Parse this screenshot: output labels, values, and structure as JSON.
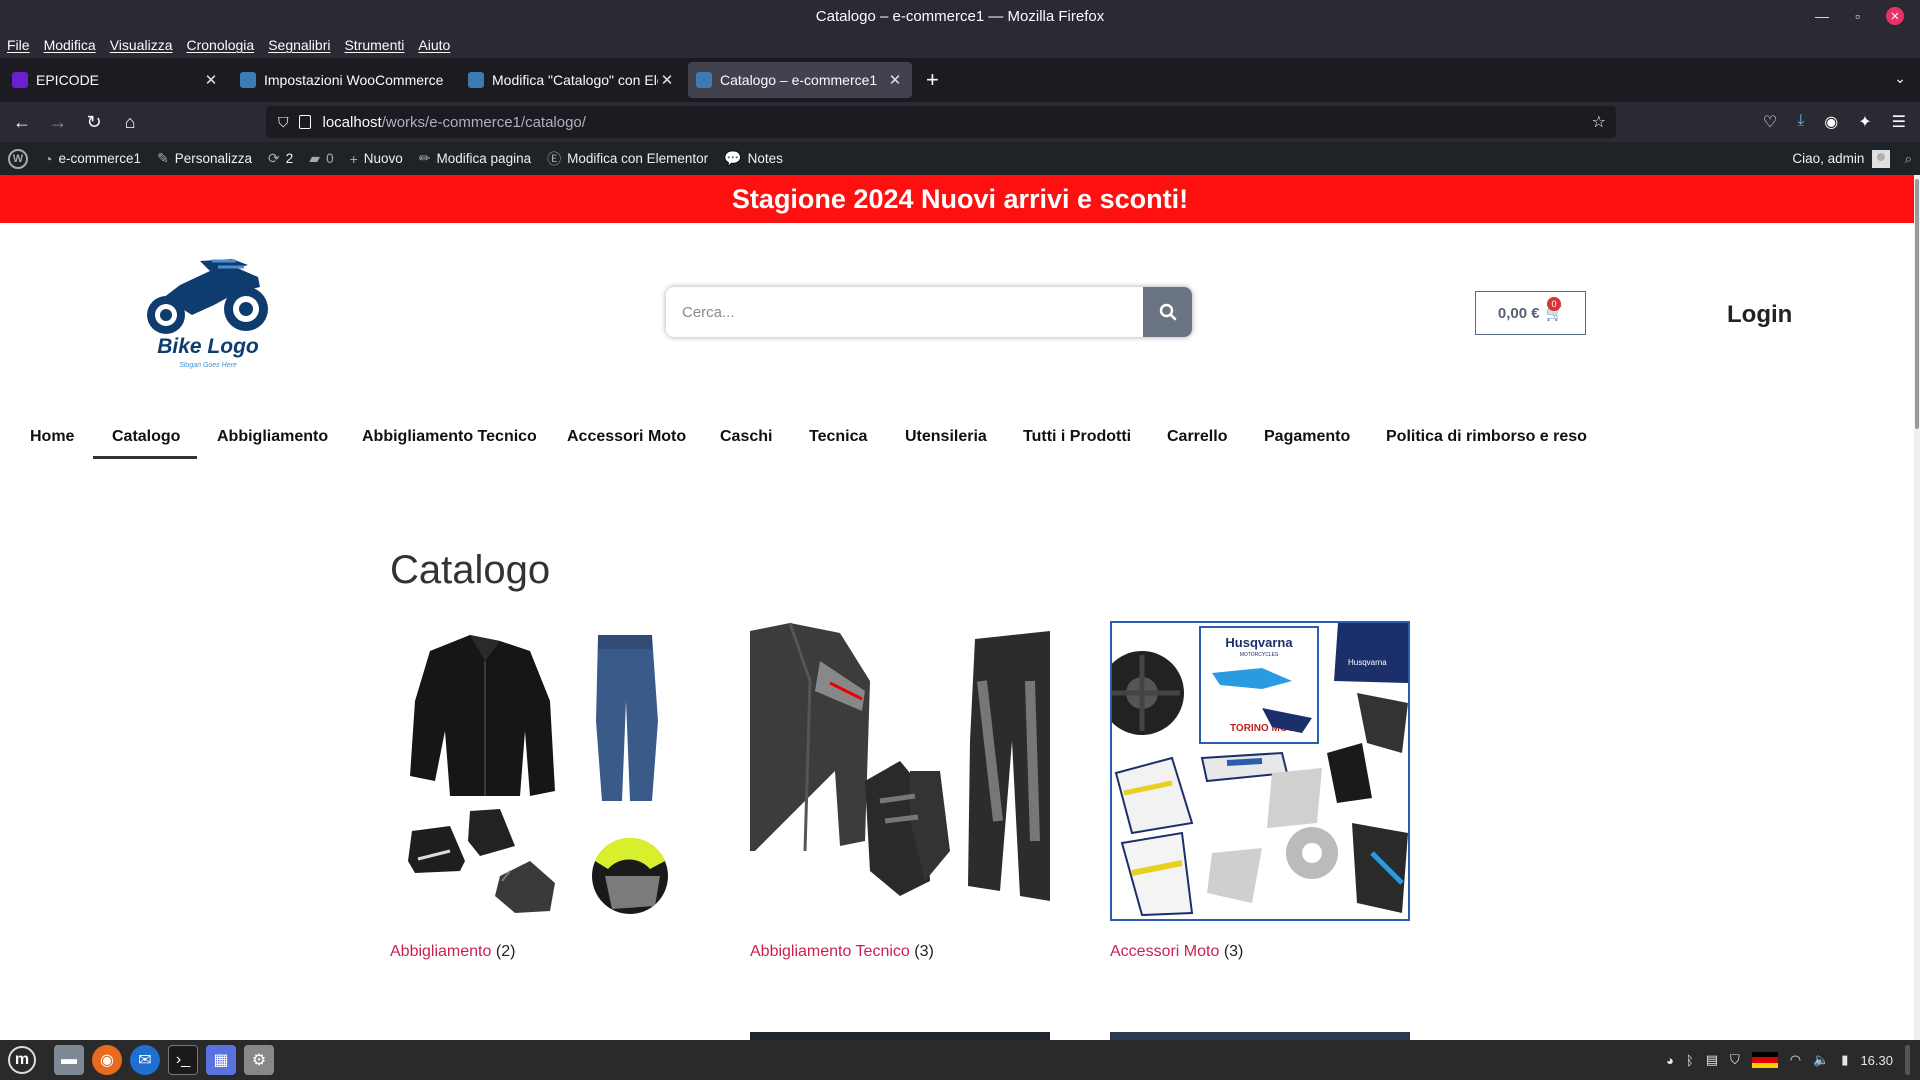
{
  "window": {
    "title": "Catalogo – e-commerce1 — Mozilla Firefox"
  },
  "menubar": [
    "File",
    "Modifica",
    "Visualizza",
    "Cronologia",
    "Segnalibri",
    "Strumenti",
    "Aiuto"
  ],
  "tabs": [
    {
      "label": "EPICODE",
      "color": "#6b1fd1"
    },
    {
      "label": "Impostazioni WooCommerce",
      "color": "#3c7bb5"
    },
    {
      "label": "Modifica \"Catalogo\" con Ele",
      "color": "#3c7bb5"
    },
    {
      "label": "Catalogo – e-commerce1",
      "color": "#3c7bb5"
    }
  ],
  "url": {
    "host": "localhost",
    "path": "/works/e-commerce1/catalogo/"
  },
  "wpbar": {
    "site": "e-commerce1",
    "customize": "Personalizza",
    "updates": "2",
    "comments": "0",
    "new": "Nuovo",
    "edit_page": "Modifica pagina",
    "edit_elementor": "Modifica con Elementor",
    "notes": "Notes",
    "greeting": "Ciao, admin"
  },
  "promo": "Stagione 2024 Nuovi arrivi e sconti!",
  "logo": {
    "title": "Bike Logo",
    "slogan": "Slogan Goes Here",
    "color": "#0f3c6e"
  },
  "search": {
    "placeholder": "Cerca..."
  },
  "cart": {
    "amount": "0,00 €",
    "count": "0"
  },
  "login": "Login",
  "nav": [
    "Home",
    "Catalogo",
    "Abbigliamento",
    "Abbigliamento Tecnico",
    "Accessori Moto",
    "Caschi",
    "Tecnica",
    "Utensileria",
    "Tutti i Prodotti",
    "Carrello",
    "Pagamento",
    "Politica di rimborso e reso"
  ],
  "page_title": "Catalogo",
  "categories": [
    {
      "name": "Abbigliamento",
      "count": "(2)"
    },
    {
      "name": "Abbigliamento Tecnico",
      "count": "(3)"
    },
    {
      "name": "Accessori Moto",
      "count": "(3)"
    }
  ],
  "husqvarna": {
    "brand": "Husqvarna",
    "sub": "MOTORCYCLES",
    "dealer": "TORINO MOTO"
  },
  "taskbar": {
    "time": "16.30"
  }
}
